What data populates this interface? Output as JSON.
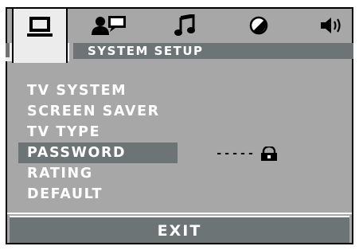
{
  "tabs": [
    {
      "icon": "monitor-icon",
      "active": true
    },
    {
      "icon": "person-tv-icon",
      "active": false
    },
    {
      "icon": "music-note-icon",
      "active": false
    },
    {
      "icon": "circle-slash-icon",
      "active": false
    },
    {
      "icon": "speaker-icon",
      "active": false
    }
  ],
  "header": {
    "title": "SYSTEM SETUP"
  },
  "menu": {
    "items": [
      {
        "label": "TV SYSTEM",
        "selected": false
      },
      {
        "label": "SCREEN SAVER",
        "selected": false
      },
      {
        "label": "TV TYPE",
        "selected": false
      },
      {
        "label": "PASSWORD",
        "selected": true
      },
      {
        "label": "RATING",
        "selected": false
      },
      {
        "label": "DEFAULT",
        "selected": false
      }
    ]
  },
  "password": {
    "value": "-----",
    "icon": "lock-icon"
  },
  "footer": {
    "exit_label": "EXIT"
  },
  "colors": {
    "background": "#a7a7a7",
    "bar": "#6d7475",
    "active_tab": "#ececec",
    "text": "#ffffff"
  }
}
